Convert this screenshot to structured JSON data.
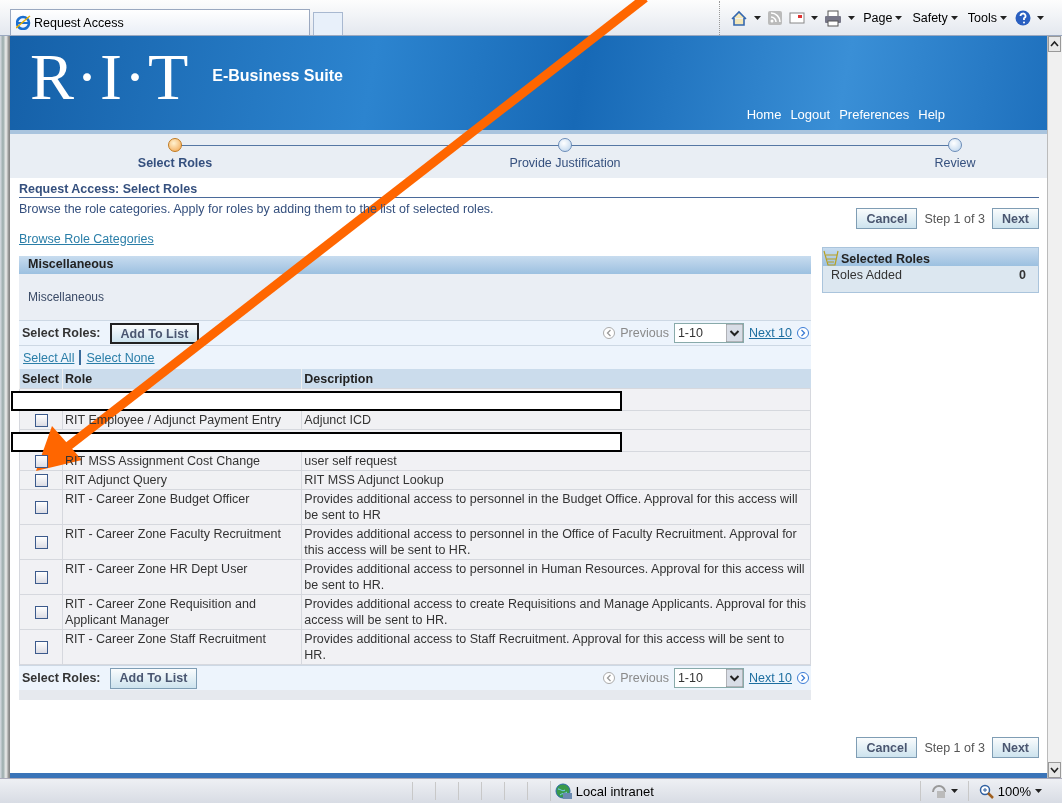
{
  "browser": {
    "tab_title": "Request Access",
    "menus": [
      "Page",
      "Safety",
      "Tools"
    ]
  },
  "header": {
    "logo": "R·I·T",
    "app_name": "E-Business Suite",
    "links": [
      "Home",
      "Logout",
      "Preferences",
      "Help"
    ]
  },
  "train": [
    {
      "label": "Select Roles",
      "selected": true
    },
    {
      "label": "Provide Justification",
      "selected": false
    },
    {
      "label": "Review",
      "selected": false
    }
  ],
  "page": {
    "title": "Request Access: Select Roles",
    "instruction": "Browse the role categories. Apply for roles by adding them to the list of selected roles.",
    "browse_link": "Browse Role Categories"
  },
  "top_actions": {
    "cancel": "Cancel",
    "step": "Step 1 of 3",
    "next": "Next"
  },
  "category": {
    "title": "Miscellaneous",
    "description": "Miscellaneous"
  },
  "table": {
    "top_bar": {
      "label": "Select Roles:",
      "button": "Add To List",
      "previous": "Previous",
      "range": "1-10",
      "next": "Next 10"
    },
    "select_all": "Select All",
    "select_none": "Select None",
    "columns": [
      "Select",
      "Role",
      "Description"
    ],
    "rows": [
      {
        "kind": "redacted"
      },
      {
        "kind": "role",
        "checked": false,
        "role": "RIT Employee / Adjunct Payment Entry",
        "description": "Adjunct ICD"
      },
      {
        "kind": "redacted"
      },
      {
        "kind": "role",
        "checked": false,
        "role": "RIT MSS Assignment Cost Change",
        "description": "user self request"
      },
      {
        "kind": "role",
        "checked": false,
        "role": "RIT Adjunct Query",
        "description": "RIT MSS Adjunct Lookup"
      },
      {
        "kind": "role",
        "checked": false,
        "role": "RIT - Career Zone Budget Officer",
        "description": "Provides additional access to personnel in the Budget Office. Approval for this access will be sent to HR"
      },
      {
        "kind": "role",
        "checked": false,
        "role": "RIT - Career Zone Faculty Recruitment",
        "description": "Provides additional access to personnel in the Office of Faculty Recruitment. Approval for this access will be sent to HR."
      },
      {
        "kind": "role",
        "checked": false,
        "role": "RIT - Career Zone HR Dept User",
        "description": "Provides additional access to personnel in Human Resources. Approval for this access will be sent to HR."
      },
      {
        "kind": "role",
        "checked": false,
        "role": "RIT - Career Zone Requisition and Applicant Manager",
        "description": "Provides additional access to create Requisitions and Manage Applicants. Approval for this access will be sent to HR."
      },
      {
        "kind": "role",
        "checked": false,
        "role": "RIT - Career Zone Staff Recruitment",
        "description": "Provides additional access to Staff Recruitment. Approval for this access will be sent to HR."
      }
    ],
    "bottom_bar": {
      "label": "Select Roles:",
      "button": "Add To List",
      "previous": "Previous",
      "range": "1-10",
      "next": "Next 10"
    }
  },
  "selected_roles": {
    "title": "Selected Roles",
    "label": "Roles Added",
    "count": "0"
  },
  "bottom_actions": {
    "cancel": "Cancel",
    "step": "Step 1 of 3",
    "next": "Next"
  },
  "status_bar": {
    "zone": "Local intranet",
    "zoom": "100%"
  }
}
